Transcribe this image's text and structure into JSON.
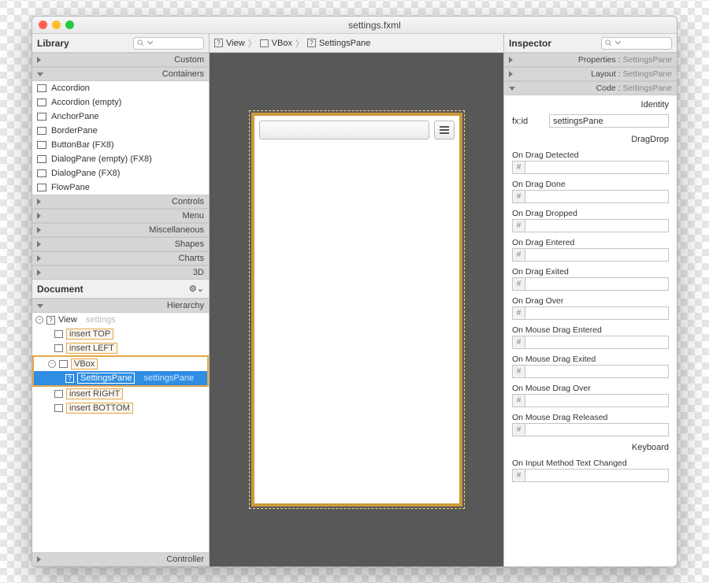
{
  "window_title": "settings.fxml",
  "library": {
    "title": "Library",
    "sections": {
      "custom": "Custom",
      "containers": "Containers",
      "controls": "Controls",
      "menu": "Menu",
      "misc": "Miscellaneous",
      "shapes": "Shapes",
      "charts": "Charts",
      "threeD": "3D"
    },
    "containers": [
      "Accordion",
      "Accordion  (empty)",
      "AnchorPane",
      "BorderPane",
      "ButtonBar   (FX8)",
      "DialogPane (empty)   (FX8)",
      "DialogPane   (FX8)",
      "FlowPane"
    ]
  },
  "document": {
    "title": "Document",
    "hierarchy": "Hierarchy",
    "controller": "Controller",
    "tree": {
      "view": "View",
      "view_sub": "settings",
      "insert_top": "insert TOP",
      "insert_left": "insert LEFT",
      "vbox": "VBox",
      "settings_pane": "SettingsPane",
      "settings_pane_id": "settingsPane",
      "insert_right": "insert RIGHT",
      "insert_bottom": "insert BOTTOM"
    }
  },
  "breadcrumb": {
    "a": "View",
    "b": "VBox",
    "c": "SettingsPane"
  },
  "inspector": {
    "title": "Inspector",
    "properties": "Properties",
    "layout": "Layout",
    "code": "Code",
    "target": "SettingsPane",
    "identity": "Identity",
    "fxid_label": "fx:id",
    "fxid_value": "settingsPane",
    "dragdrop": "DragDrop",
    "events": [
      "On Drag Detected",
      "On Drag Done",
      "On Drag Dropped",
      "On Drag Entered",
      "On Drag Exited",
      "On Drag Over",
      "On Mouse Drag Entered",
      "On Mouse Drag Exited",
      "On Mouse Drag Over",
      "On Mouse Drag Released"
    ],
    "keyboard": "Keyboard",
    "keyboard_events": [
      "On Input Method Text Changed"
    ]
  }
}
